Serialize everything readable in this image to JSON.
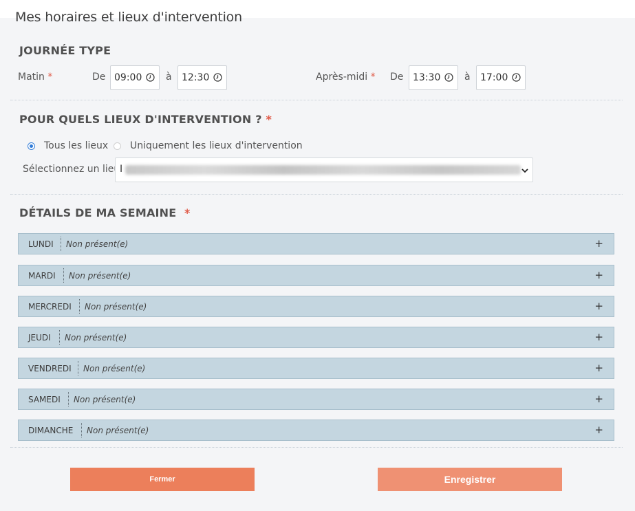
{
  "page_title": "Mes horaires et lieux d'intervention",
  "typical_day": {
    "heading": "JOURNÉE TYPE",
    "required_mark": "*",
    "morning": {
      "label": "Matin",
      "from_label": "De",
      "from_value": "09:00",
      "to_label": "à",
      "to_value": "12:30"
    },
    "afternoon": {
      "label": "Après-midi",
      "from_label": "De",
      "from_value": "13:30",
      "to_label": "à",
      "to_value": "17:00"
    }
  },
  "locations": {
    "heading": "POUR QUELS LIEUX D'INTERVENTION ?",
    "required_mark": "*",
    "options": [
      {
        "label": "Tous les lieux",
        "checked": true
      },
      {
        "label": "Uniquement les lieux d'intervention",
        "checked": false
      }
    ],
    "select_label": "Sélectionnez un lieu",
    "select_prefix": "I"
  },
  "week": {
    "heading": "DÉTAILS DE MA SEMAINE",
    "required_mark": "*",
    "days": [
      {
        "name": "LUNDI",
        "status": "Non présent(e)"
      },
      {
        "name": "MARDI",
        "status": "Non présent(e)"
      },
      {
        "name": "MERCREDI",
        "status": "Non présent(e)"
      },
      {
        "name": "JEUDI",
        "status": "Non présent(e)"
      },
      {
        "name": "VENDREDI",
        "status": "Non présent(e)"
      },
      {
        "name": "SAMEDI",
        "status": "Non présent(e)"
      },
      {
        "name": "DIMANCHE",
        "status": "Non présent(e)"
      }
    ],
    "expand_symbol": "+"
  },
  "buttons": {
    "close_label": "Fermer",
    "save_label": "Enregistrer"
  },
  "colors": {
    "accent": "#ec7f5b",
    "save": "#ef9173",
    "day_row": "#c4d6e0",
    "required": "#e05a48",
    "radio_selected": "#2f7bd8"
  },
  "icons": {
    "time": "clock-icon",
    "select": "chevron-down-icon",
    "expand": "plus-icon"
  }
}
